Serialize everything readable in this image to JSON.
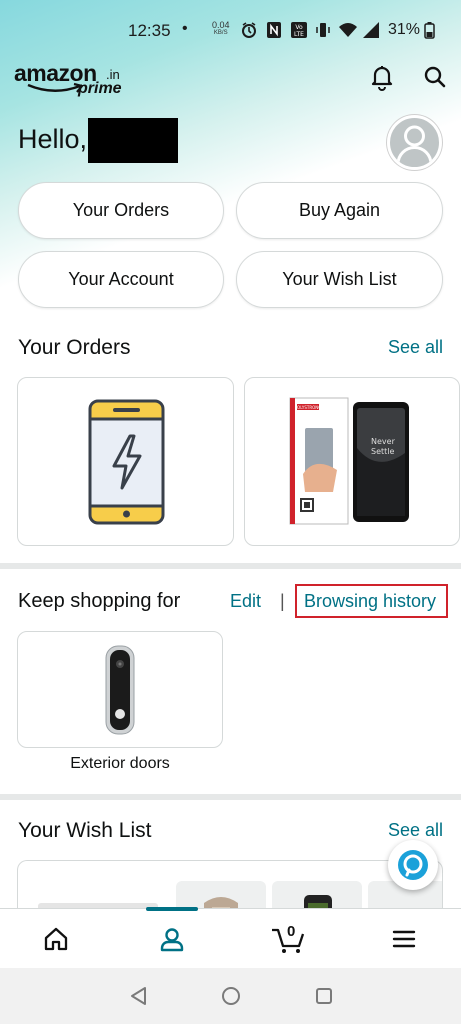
{
  "status_bar": {
    "time": "12:35",
    "dot": "•",
    "net_speed": "0.04",
    "net_unit": "KB/S",
    "battery": "31%"
  },
  "header": {
    "logo_word": "amazon",
    "logo_tld": ".in",
    "logo_prime": "prime",
    "icons": [
      "bell-icon",
      "search-icon"
    ]
  },
  "greeting": {
    "text": "Hello,"
  },
  "quick_buttons": {
    "your_orders": "Your Orders",
    "buy_again": "Buy Again",
    "your_account": "Your Account",
    "your_wish_list": "Your Wish List"
  },
  "orders_section": {
    "title": "Your Orders",
    "see_all": "See all",
    "screen_protector_brand": "POLYSTRONG",
    "phone_text_1": "Never",
    "phone_text_2": "Settle"
  },
  "keep_shopping": {
    "title": "Keep shopping for",
    "edit": "Edit",
    "separator": "|",
    "browsing_history": "Browsing history",
    "item_label": "Exterior doors"
  },
  "wish_list_section": {
    "title": "Your Wish List",
    "see_all": "See all"
  },
  "bottom_nav": {
    "items": [
      "home-icon",
      "profile-icon",
      "cart-icon",
      "menu-icon"
    ],
    "cart_count": "0",
    "active": "profile-icon"
  },
  "colors": {
    "link": "#007185",
    "highlight_box": "#d0222b",
    "header_gradient": "#86d8de"
  }
}
